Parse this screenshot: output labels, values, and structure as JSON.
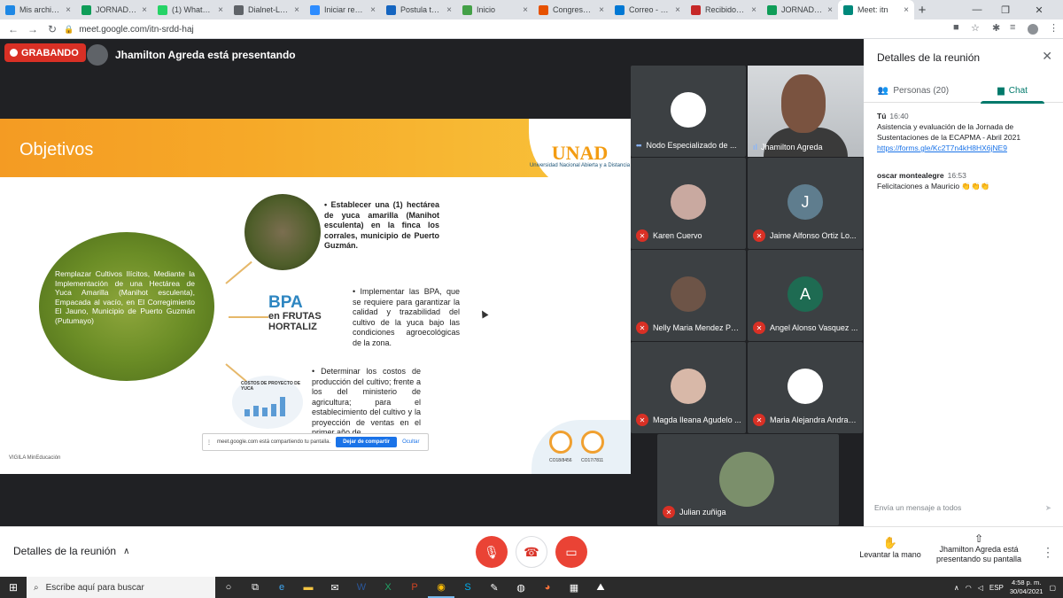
{
  "browser": {
    "tabs": [
      {
        "label": "Mis archivos",
        "color": "#1e88e5"
      },
      {
        "label": "JORNADA DE",
        "color": "#0f9d58"
      },
      {
        "label": "(1) WhatsApp",
        "color": "#25d366"
      },
      {
        "label": "Dialnet-LATE",
        "color": "#5f6368"
      },
      {
        "label": "Iniciar reunió",
        "color": "#2d8cff"
      },
      {
        "label": "Postula tu tra",
        "color": "#1565c0"
      },
      {
        "label": "Inicio",
        "color": "#43a047"
      },
      {
        "label": "Congreso Inte",
        "color": "#e65100"
      },
      {
        "label": "Correo - Univ",
        "color": "#0078d4"
      },
      {
        "label": "Recibidos (30",
        "color": "#c62828"
      },
      {
        "label": "JORNADA DE",
        "color": "#0f9d58"
      },
      {
        "label": "Meet: itn",
        "color": "#00897b"
      }
    ],
    "url": "meet.google.com/itn-srdd-haj",
    "new_tab": "+",
    "win_min": "—",
    "win_max": "❐",
    "win_close": "✕"
  },
  "meet": {
    "recording_label": "GRABANDO",
    "presenter_text": "Jhamilton Agreda está presentando"
  },
  "slide": {
    "title": "Objetivos",
    "logo_text": "UNAD",
    "logo_sub": "Universidad Nacional Abierta y a Distancia",
    "ellipse_text": "Remplazar Cultivos Ilícitos, Mediante la Implementación de una Hectárea de Yuca Amarilla (Manihot esculenta), Empacada al vacío, en El Corregimiento El Jauno, Municipio de Puerto Guzmán (Putumayo)",
    "objective_1": "• Establecer una (1) hectárea de yuca amarilla (Manihot esculenta) en la finca los corrales, municipio de Puerto Guzmán.",
    "objective_2": "• Implementar las BPA, que se requiere para garantizar la calidad y trazabilidad del cultivo de la yuca bajo las condiciones agroecológicas de la zona.",
    "objective_3": "• Determinar los costos de producción del cultivo; frente a los del ministerio de agricultura; para el establecimiento del cultivo y la proyección de ventas en el primer año de",
    "bpa_line1": "BPA",
    "bpa_line2": "en FRUTAS",
    "bpa_line3": "HORTALIZ",
    "chart_title": "COSTOS DE PROYECTO DE YUCA",
    "vigila": "VIGILA  MinEducación",
    "sgs_1": "CO18/8456",
    "sgs_2": "CO17/7811",
    "share_text": "meet.google.com está compartiendo tu pantalla.",
    "share_stop": "Dejar de compartir",
    "share_hide": "Ocultar"
  },
  "participants": [
    {
      "name": "Nodo Especializado de ...",
      "initial": "",
      "muted": false,
      "bg": "#ffffff"
    },
    {
      "name": "Jhamilton Agreda",
      "initial": "",
      "muted": false,
      "bg": ""
    },
    {
      "name": "Karen Cuervo",
      "initial": "",
      "muted": true,
      "bg": "#c9a9a0"
    },
    {
      "name": "Jaime Alfonso Ortiz Lo...",
      "initial": "J",
      "muted": true,
      "bg": "#5f7d8e"
    },
    {
      "name": "Nelly Maria Mendez Ped...",
      "initial": "",
      "muted": true,
      "bg": "#6d5447"
    },
    {
      "name": "Angel Alonso Vasquez ...",
      "initial": "A",
      "muted": true,
      "bg": "#1e6b52"
    },
    {
      "name": "Magda Ileana Agudelo ...",
      "initial": "",
      "muted": true,
      "bg": "#d8b8a8"
    },
    {
      "name": "Maria Alejandra Andrad...",
      "initial": "",
      "muted": true,
      "bg": "#ffffff"
    },
    {
      "name": "Julian zuñiga",
      "initial": "",
      "muted": true,
      "bg": "#7b8f6b"
    }
  ],
  "panel": {
    "title": "Detalles de la reunión",
    "tab_people": "Personas (20)",
    "tab_chat": "Chat",
    "messages": [
      {
        "who": "Tú",
        "time": "16:40",
        "text": "Asistencia y evaluación de la Jornada de Sustentaciones de la ECAPMA - Abril 2021",
        "link": "https://forms.gle/Kc2T7n4kH8HX6jNE9"
      },
      {
        "who": "oscar montealegre",
        "time": "16:53",
        "text": "Felicitaciones a Mauricio 👏👏👏",
        "link": ""
      }
    ],
    "input_placeholder": "Envía un mensaje a todos"
  },
  "controls": {
    "details": "Detalles de la reunión",
    "raise_hand": "Levantar la mano",
    "presenting": "Jhamilton Agreda está presentando su pantalla"
  },
  "taskbar": {
    "search": "Escribe aquí para buscar",
    "lang": "ESP",
    "time": "4:58 p. m.",
    "date": "30/04/2021"
  }
}
